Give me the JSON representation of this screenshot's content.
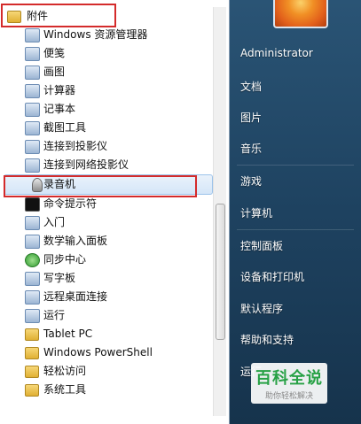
{
  "start_menu": {
    "programs": {
      "folder_label": "附件",
      "items": [
        {
          "label": "Windows 资源管理器",
          "icon": "explorer-icon",
          "kind": "app"
        },
        {
          "label": "便笺",
          "icon": "sticky-notes-icon",
          "kind": "app"
        },
        {
          "label": "画图",
          "icon": "paint-icon",
          "kind": "app"
        },
        {
          "label": "计算器",
          "icon": "calculator-icon",
          "kind": "app"
        },
        {
          "label": "记事本",
          "icon": "notepad-icon",
          "kind": "app"
        },
        {
          "label": "截图工具",
          "icon": "snipping-tool-icon",
          "kind": "app"
        },
        {
          "label": "连接到投影仪",
          "icon": "projector-icon",
          "kind": "app"
        },
        {
          "label": "连接到网络投影仪",
          "icon": "network-projector-icon",
          "kind": "app"
        },
        {
          "label": "录音机",
          "icon": "microphone-icon",
          "kind": "mic"
        },
        {
          "label": "命令提示符",
          "icon": "command-prompt-icon",
          "kind": "cmd"
        },
        {
          "label": "入门",
          "icon": "getting-started-icon",
          "kind": "app"
        },
        {
          "label": "数学输入面板",
          "icon": "math-input-icon",
          "kind": "app"
        },
        {
          "label": "同步中心",
          "icon": "sync-center-icon",
          "kind": "green"
        },
        {
          "label": "写字板",
          "icon": "wordpad-icon",
          "kind": "app"
        },
        {
          "label": "远程桌面连接",
          "icon": "remote-desktop-icon",
          "kind": "app"
        },
        {
          "label": "运行",
          "icon": "run-icon",
          "kind": "app"
        },
        {
          "label": "Tablet PC",
          "icon": "folder-icon",
          "kind": "folder"
        },
        {
          "label": "Windows PowerShell",
          "icon": "folder-icon",
          "kind": "folder"
        },
        {
          "label": "轻松访问",
          "icon": "folder-icon",
          "kind": "folder"
        },
        {
          "label": "系统工具",
          "icon": "folder-icon",
          "kind": "folder"
        }
      ],
      "selected_label": "录音机"
    },
    "right_pane": {
      "user_name": "Administrator",
      "items": [
        "文档",
        "图片",
        "音乐",
        "游戏",
        "计算机",
        "控制面板",
        "设备和打印机",
        "默认程序",
        "帮助和支持",
        "运行..."
      ]
    }
  },
  "watermark": {
    "title": "百科全说",
    "subtitle": "助你轻松解决"
  },
  "colors": {
    "highlight_border": "#d42b2b",
    "selection_fill": "#d5e6f8",
    "right_pane_bg": "#1e4260",
    "watermark_green": "#27a145"
  }
}
